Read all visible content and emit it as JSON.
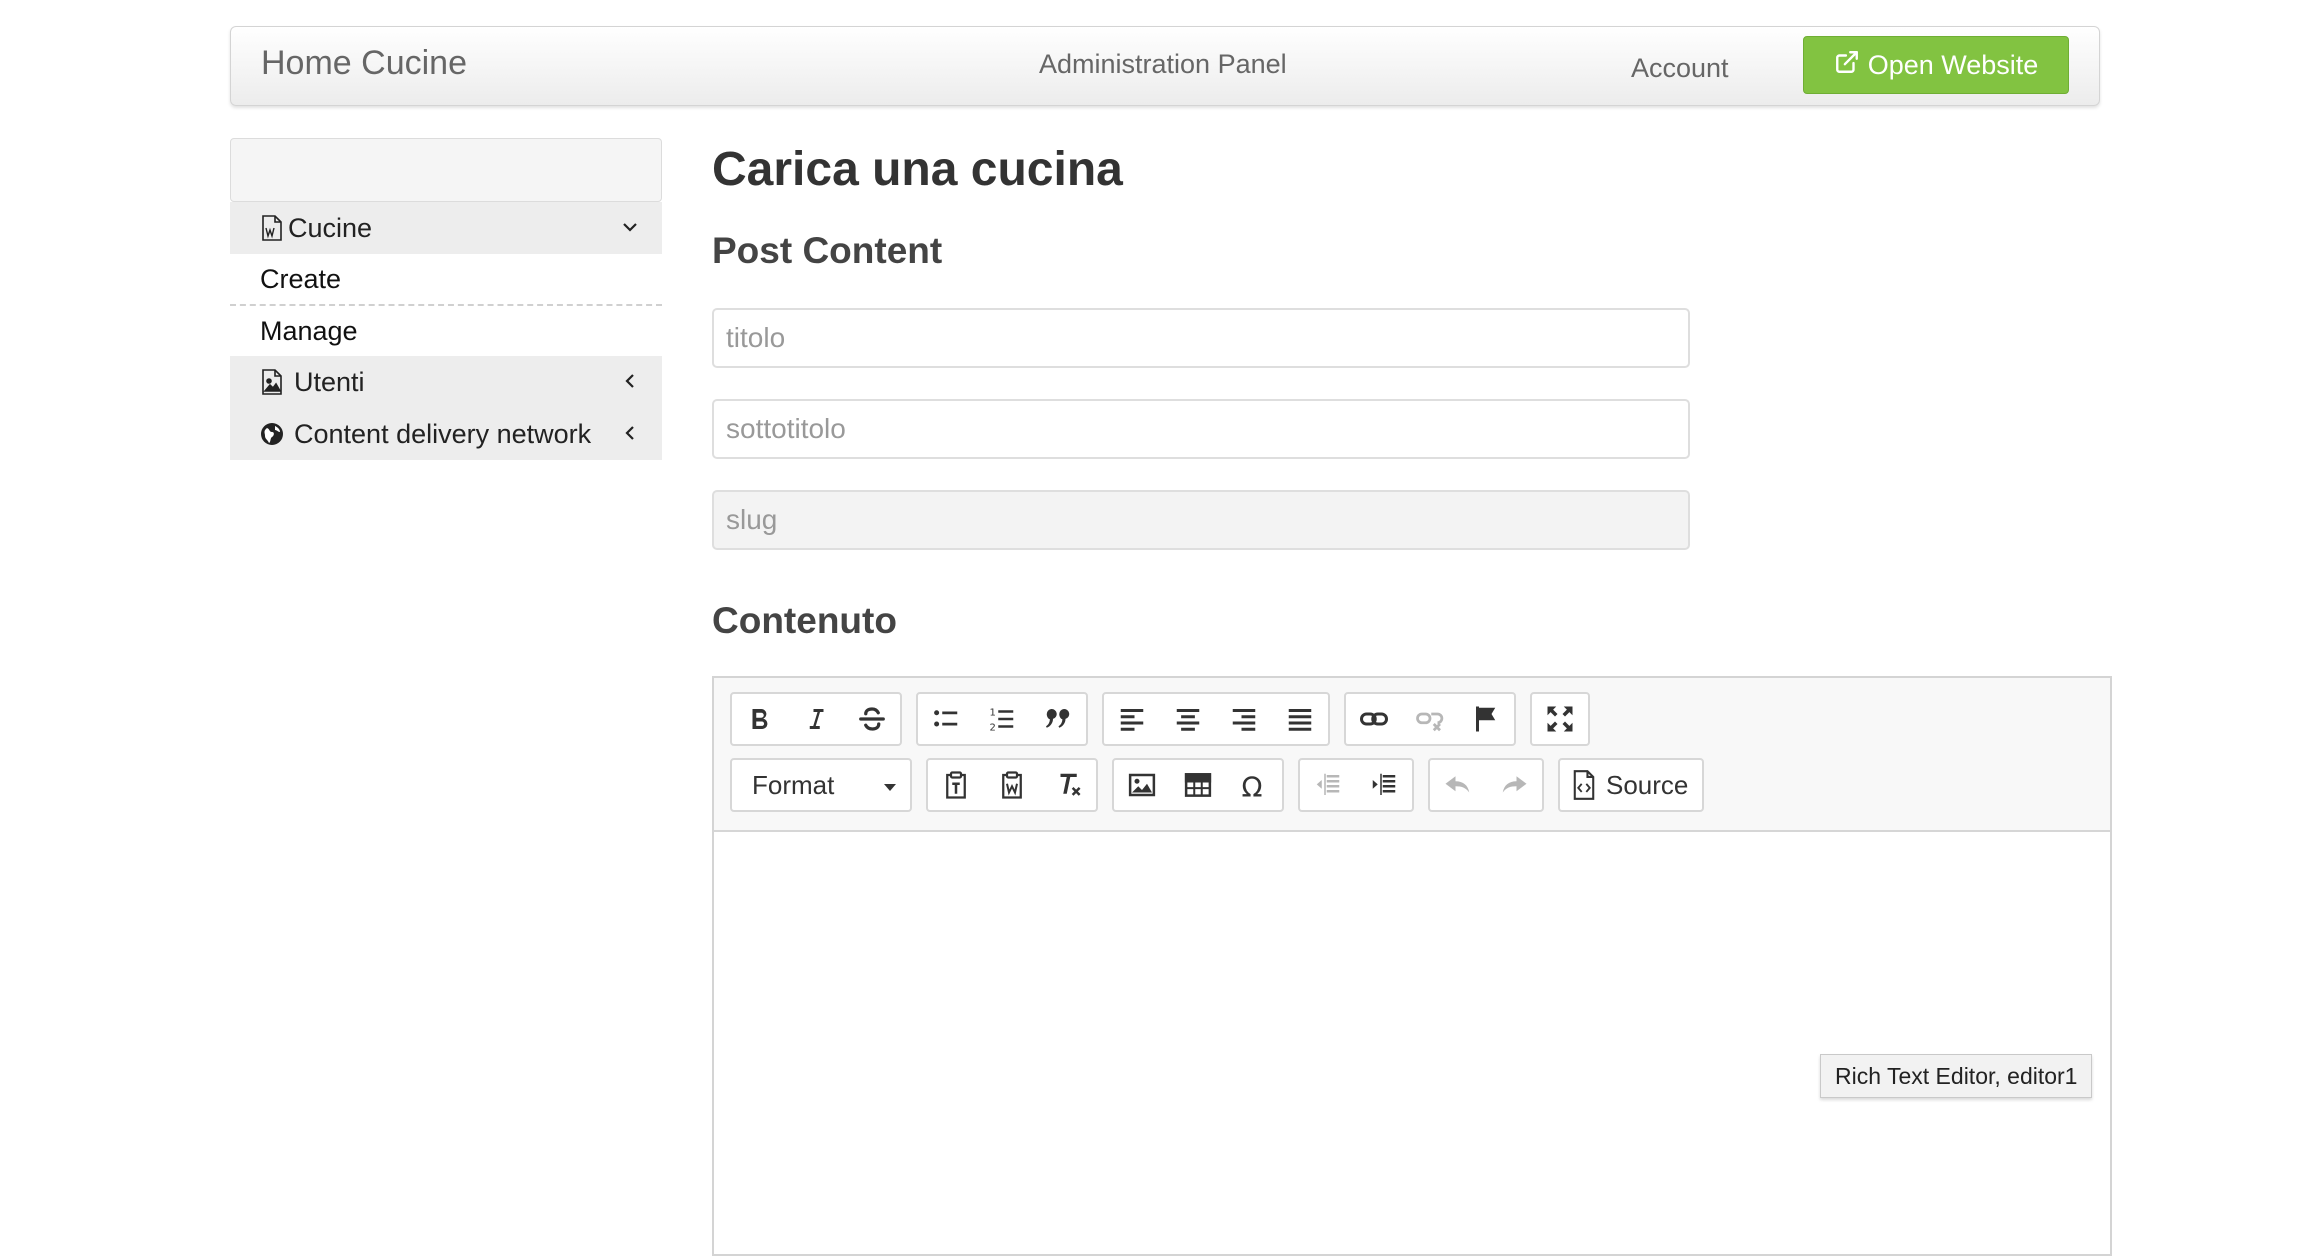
{
  "navbar": {
    "brand": "Home Cucine",
    "panel_title": "Administration Panel",
    "account": "Account",
    "open_website": "Open Website",
    "open_website_icon": "external-link-icon",
    "accent_color": "#82c341"
  },
  "sidebar": {
    "groups": [
      {
        "label": "Cucine",
        "icon": "word-document-icon",
        "chevron": "chevron-down-icon",
        "items": [
          "Create",
          "Manage"
        ]
      },
      {
        "label": "Utenti",
        "icon": "image-file-icon",
        "chevron": "chevron-left-icon"
      },
      {
        "label": "Content delivery network",
        "icon": "globe-icon",
        "chevron": "chevron-left-icon"
      }
    ]
  },
  "main": {
    "page_title": "Carica una cucina",
    "post_content_title": "Post Content",
    "fields": {
      "title_placeholder": "titolo",
      "subtitle_placeholder": "sottotitolo",
      "slug_placeholder": "slug"
    },
    "content_title": "Contenuto"
  },
  "editor": {
    "format_label": "Format",
    "source_label": "Source",
    "tooltip": "Rich Text Editor, editor1",
    "buttons": [
      "bold",
      "italic",
      "strikethrough",
      "bulleted-list",
      "numbered-list",
      "blockquote",
      "align-left",
      "align-center",
      "align-right",
      "justify",
      "link",
      "unlink",
      "anchor",
      "maximize",
      "paste-text",
      "paste-from-word",
      "remove-format",
      "image",
      "table",
      "special-character",
      "outdent",
      "indent",
      "undo",
      "redo",
      "source"
    ]
  }
}
